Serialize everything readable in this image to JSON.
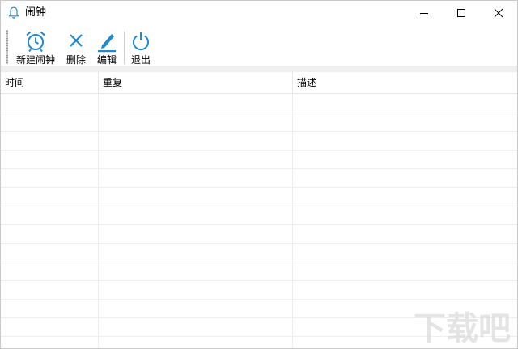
{
  "window": {
    "title": "闹钟",
    "controls": [
      "minimize-icon",
      "maximize-icon",
      "close-icon"
    ]
  },
  "toolbar": {
    "new_label": "新建闹钟",
    "delete_label": "删除",
    "edit_label": "编辑",
    "exit_label": "退出",
    "icons": {
      "new": "alarm-clock-icon",
      "delete": "x-icon",
      "edit": "pencil-icon",
      "exit": "power-icon"
    },
    "accent": "#1e88d3"
  },
  "table": {
    "columns": [
      "时间",
      "重复",
      "描述"
    ],
    "rows": []
  },
  "watermark": "下载吧"
}
